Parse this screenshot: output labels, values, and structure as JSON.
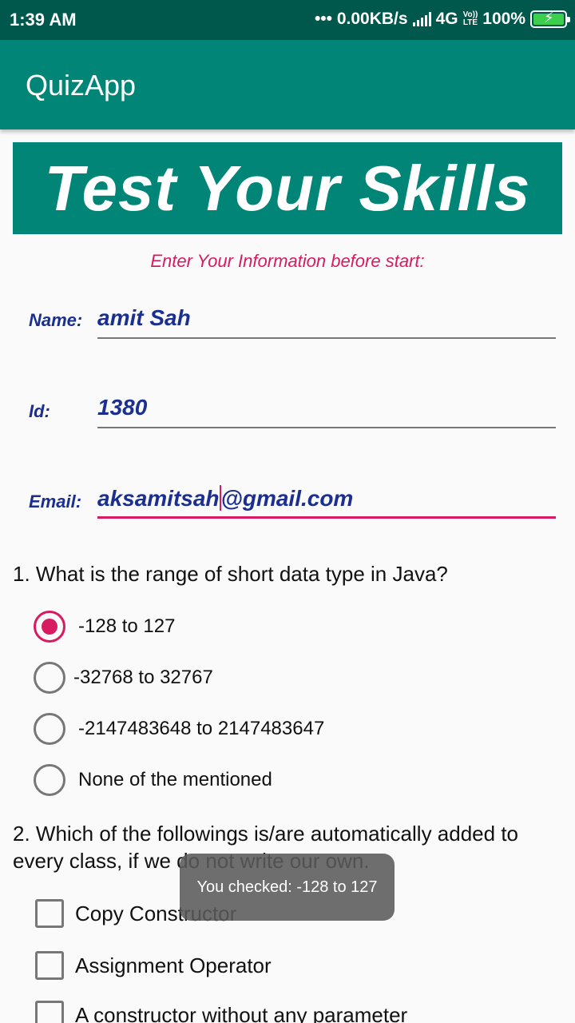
{
  "status_bar": {
    "time": "1:39 AM",
    "network": "••• 0.00KB/s",
    "net_type": "4G",
    "volte_top": "Vo))",
    "volte_bottom": "LTE",
    "battery": "100%",
    "icons": [
      "signal-icon",
      "volte-icon",
      "battery-charging-icon"
    ]
  },
  "app_bar": {
    "title": "QuizApp"
  },
  "banner": {
    "text": "Test Your Skills"
  },
  "intro": "Enter Your Information before start:",
  "form": {
    "name_label": "Name:",
    "name_value": "amit Sah",
    "id_label": "Id:",
    "id_value": "1380",
    "email_label": "Email:",
    "email_value_before_cursor": "aksamitsah",
    "email_value_after_cursor": "@gmail.com"
  },
  "question1": {
    "text": "1. What is the range of short data type in Java?",
    "options": [
      {
        "label": "-128 to 127",
        "checked": true
      },
      {
        "label": "-32768 to 32767",
        "checked": false
      },
      {
        "label": "-2147483648 to 2147483647",
        "checked": false
      },
      {
        "label": "None of the mentioned",
        "checked": false
      }
    ]
  },
  "question2": {
    "text": "2. Which of the followings is/are automatically added to every class, if we do not write our own.",
    "options": [
      {
        "label": "Copy Constructor",
        "checked": false
      },
      {
        "label": "Assignment Operator",
        "checked": false
      },
      {
        "label": "A constructor without any parameter",
        "checked": false
      }
    ]
  },
  "toast": "You checked:  -128 to 127",
  "colors": {
    "status_bar": "#00574b",
    "primary": "#008577",
    "accent": "#d81b60",
    "label_blue": "#1a2f8f"
  }
}
